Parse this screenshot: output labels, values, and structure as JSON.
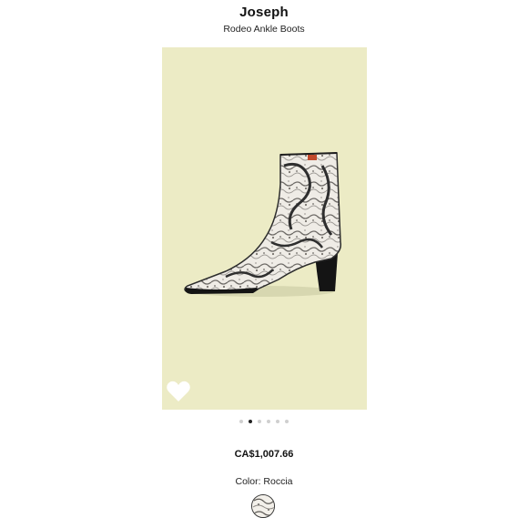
{
  "product": {
    "brand": "Joseph",
    "name": "Rodeo Ankle Boots",
    "price": "CA$1,007.66",
    "color_label": "Color: Roccia"
  },
  "gallery": {
    "background_color": "#ecebc5",
    "image_count": 6,
    "active_index": 1,
    "image_subject": "snakeskin-pattern-ankle-boot"
  },
  "icons": {
    "wishlist": "heart-icon"
  }
}
